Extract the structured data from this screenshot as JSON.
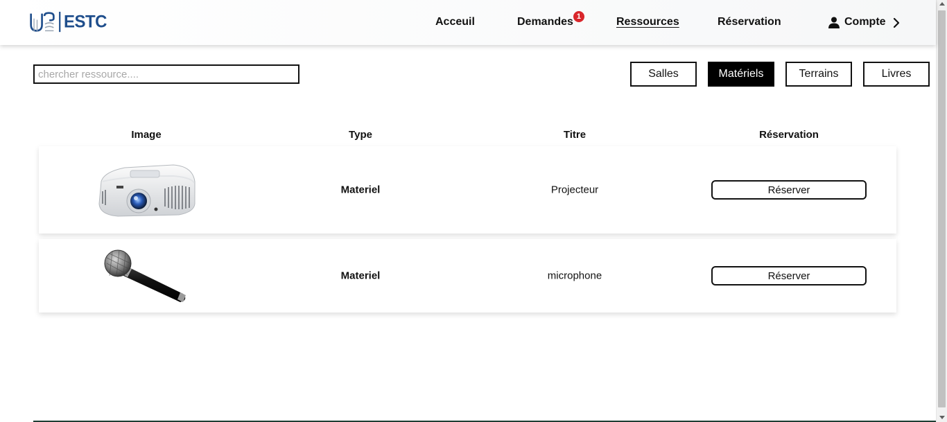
{
  "header": {
    "logo_text": "ESTC",
    "nav": {
      "home": "Acceuil",
      "requests": "Demandes",
      "requests_badge": "1",
      "resources": "Ressources",
      "reservation": "Réservation",
      "account": "Compte"
    },
    "icons": {
      "account": "user-icon",
      "account_arrow": "chevron-right-icon"
    }
  },
  "search": {
    "placeholder": "chercher ressource...."
  },
  "filters": [
    "Salles",
    "Matériels",
    "Terrains",
    "Livres"
  ],
  "active_filter": "Matériels",
  "table": {
    "headers": [
      "Image",
      "Type",
      "Titre",
      "Réservation"
    ],
    "rows": [
      {
        "image": "projector-image",
        "type": "Materiel",
        "title": "Projecteur",
        "action": "Réserver"
      },
      {
        "image": "microphone-image",
        "type": "Materiel",
        "title": "microphone",
        "action": "Réserver"
      }
    ]
  },
  "colors": {
    "brand": "#1f4e8c",
    "badge": "#d9262b",
    "active_filter_bg": "#000000"
  }
}
